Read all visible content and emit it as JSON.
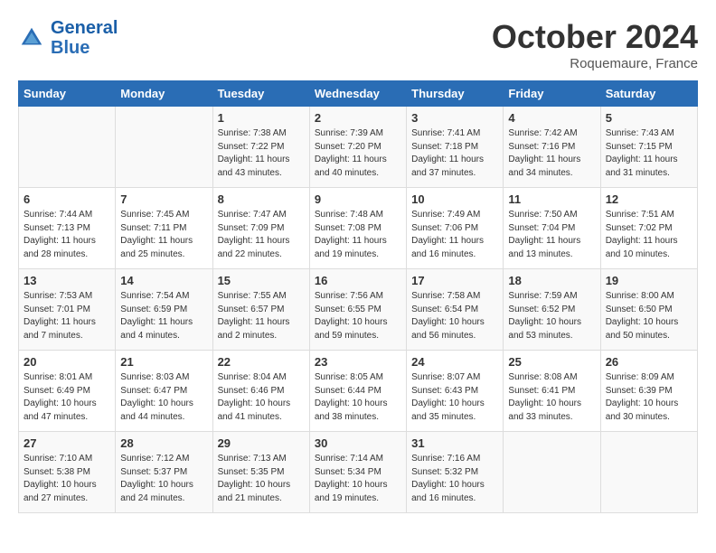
{
  "header": {
    "logo_line1": "General",
    "logo_line2": "Blue",
    "month_title": "October 2024",
    "location": "Roquemaure, France"
  },
  "days_of_week": [
    "Sunday",
    "Monday",
    "Tuesday",
    "Wednesday",
    "Thursday",
    "Friday",
    "Saturday"
  ],
  "weeks": [
    [
      {
        "num": "",
        "detail": ""
      },
      {
        "num": "",
        "detail": ""
      },
      {
        "num": "1",
        "detail": "Sunrise: 7:38 AM\nSunset: 7:22 PM\nDaylight: 11 hours\nand 43 minutes."
      },
      {
        "num": "2",
        "detail": "Sunrise: 7:39 AM\nSunset: 7:20 PM\nDaylight: 11 hours\nand 40 minutes."
      },
      {
        "num": "3",
        "detail": "Sunrise: 7:41 AM\nSunset: 7:18 PM\nDaylight: 11 hours\nand 37 minutes."
      },
      {
        "num": "4",
        "detail": "Sunrise: 7:42 AM\nSunset: 7:16 PM\nDaylight: 11 hours\nand 34 minutes."
      },
      {
        "num": "5",
        "detail": "Sunrise: 7:43 AM\nSunset: 7:15 PM\nDaylight: 11 hours\nand 31 minutes."
      }
    ],
    [
      {
        "num": "6",
        "detail": "Sunrise: 7:44 AM\nSunset: 7:13 PM\nDaylight: 11 hours\nand 28 minutes."
      },
      {
        "num": "7",
        "detail": "Sunrise: 7:45 AM\nSunset: 7:11 PM\nDaylight: 11 hours\nand 25 minutes."
      },
      {
        "num": "8",
        "detail": "Sunrise: 7:47 AM\nSunset: 7:09 PM\nDaylight: 11 hours\nand 22 minutes."
      },
      {
        "num": "9",
        "detail": "Sunrise: 7:48 AM\nSunset: 7:08 PM\nDaylight: 11 hours\nand 19 minutes."
      },
      {
        "num": "10",
        "detail": "Sunrise: 7:49 AM\nSunset: 7:06 PM\nDaylight: 11 hours\nand 16 minutes."
      },
      {
        "num": "11",
        "detail": "Sunrise: 7:50 AM\nSunset: 7:04 PM\nDaylight: 11 hours\nand 13 minutes."
      },
      {
        "num": "12",
        "detail": "Sunrise: 7:51 AM\nSunset: 7:02 PM\nDaylight: 11 hours\nand 10 minutes."
      }
    ],
    [
      {
        "num": "13",
        "detail": "Sunrise: 7:53 AM\nSunset: 7:01 PM\nDaylight: 11 hours\nand 7 minutes."
      },
      {
        "num": "14",
        "detail": "Sunrise: 7:54 AM\nSunset: 6:59 PM\nDaylight: 11 hours\nand 4 minutes."
      },
      {
        "num": "15",
        "detail": "Sunrise: 7:55 AM\nSunset: 6:57 PM\nDaylight: 11 hours\nand 2 minutes."
      },
      {
        "num": "16",
        "detail": "Sunrise: 7:56 AM\nSunset: 6:55 PM\nDaylight: 10 hours\nand 59 minutes."
      },
      {
        "num": "17",
        "detail": "Sunrise: 7:58 AM\nSunset: 6:54 PM\nDaylight: 10 hours\nand 56 minutes."
      },
      {
        "num": "18",
        "detail": "Sunrise: 7:59 AM\nSunset: 6:52 PM\nDaylight: 10 hours\nand 53 minutes."
      },
      {
        "num": "19",
        "detail": "Sunrise: 8:00 AM\nSunset: 6:50 PM\nDaylight: 10 hours\nand 50 minutes."
      }
    ],
    [
      {
        "num": "20",
        "detail": "Sunrise: 8:01 AM\nSunset: 6:49 PM\nDaylight: 10 hours\nand 47 minutes."
      },
      {
        "num": "21",
        "detail": "Sunrise: 8:03 AM\nSunset: 6:47 PM\nDaylight: 10 hours\nand 44 minutes."
      },
      {
        "num": "22",
        "detail": "Sunrise: 8:04 AM\nSunset: 6:46 PM\nDaylight: 10 hours\nand 41 minutes."
      },
      {
        "num": "23",
        "detail": "Sunrise: 8:05 AM\nSunset: 6:44 PM\nDaylight: 10 hours\nand 38 minutes."
      },
      {
        "num": "24",
        "detail": "Sunrise: 8:07 AM\nSunset: 6:43 PM\nDaylight: 10 hours\nand 35 minutes."
      },
      {
        "num": "25",
        "detail": "Sunrise: 8:08 AM\nSunset: 6:41 PM\nDaylight: 10 hours\nand 33 minutes."
      },
      {
        "num": "26",
        "detail": "Sunrise: 8:09 AM\nSunset: 6:39 PM\nDaylight: 10 hours\nand 30 minutes."
      }
    ],
    [
      {
        "num": "27",
        "detail": "Sunrise: 7:10 AM\nSunset: 5:38 PM\nDaylight: 10 hours\nand 27 minutes."
      },
      {
        "num": "28",
        "detail": "Sunrise: 7:12 AM\nSunset: 5:37 PM\nDaylight: 10 hours\nand 24 minutes."
      },
      {
        "num": "29",
        "detail": "Sunrise: 7:13 AM\nSunset: 5:35 PM\nDaylight: 10 hours\nand 21 minutes."
      },
      {
        "num": "30",
        "detail": "Sunrise: 7:14 AM\nSunset: 5:34 PM\nDaylight: 10 hours\nand 19 minutes."
      },
      {
        "num": "31",
        "detail": "Sunrise: 7:16 AM\nSunset: 5:32 PM\nDaylight: 10 hours\nand 16 minutes."
      },
      {
        "num": "",
        "detail": ""
      },
      {
        "num": "",
        "detail": ""
      }
    ]
  ]
}
